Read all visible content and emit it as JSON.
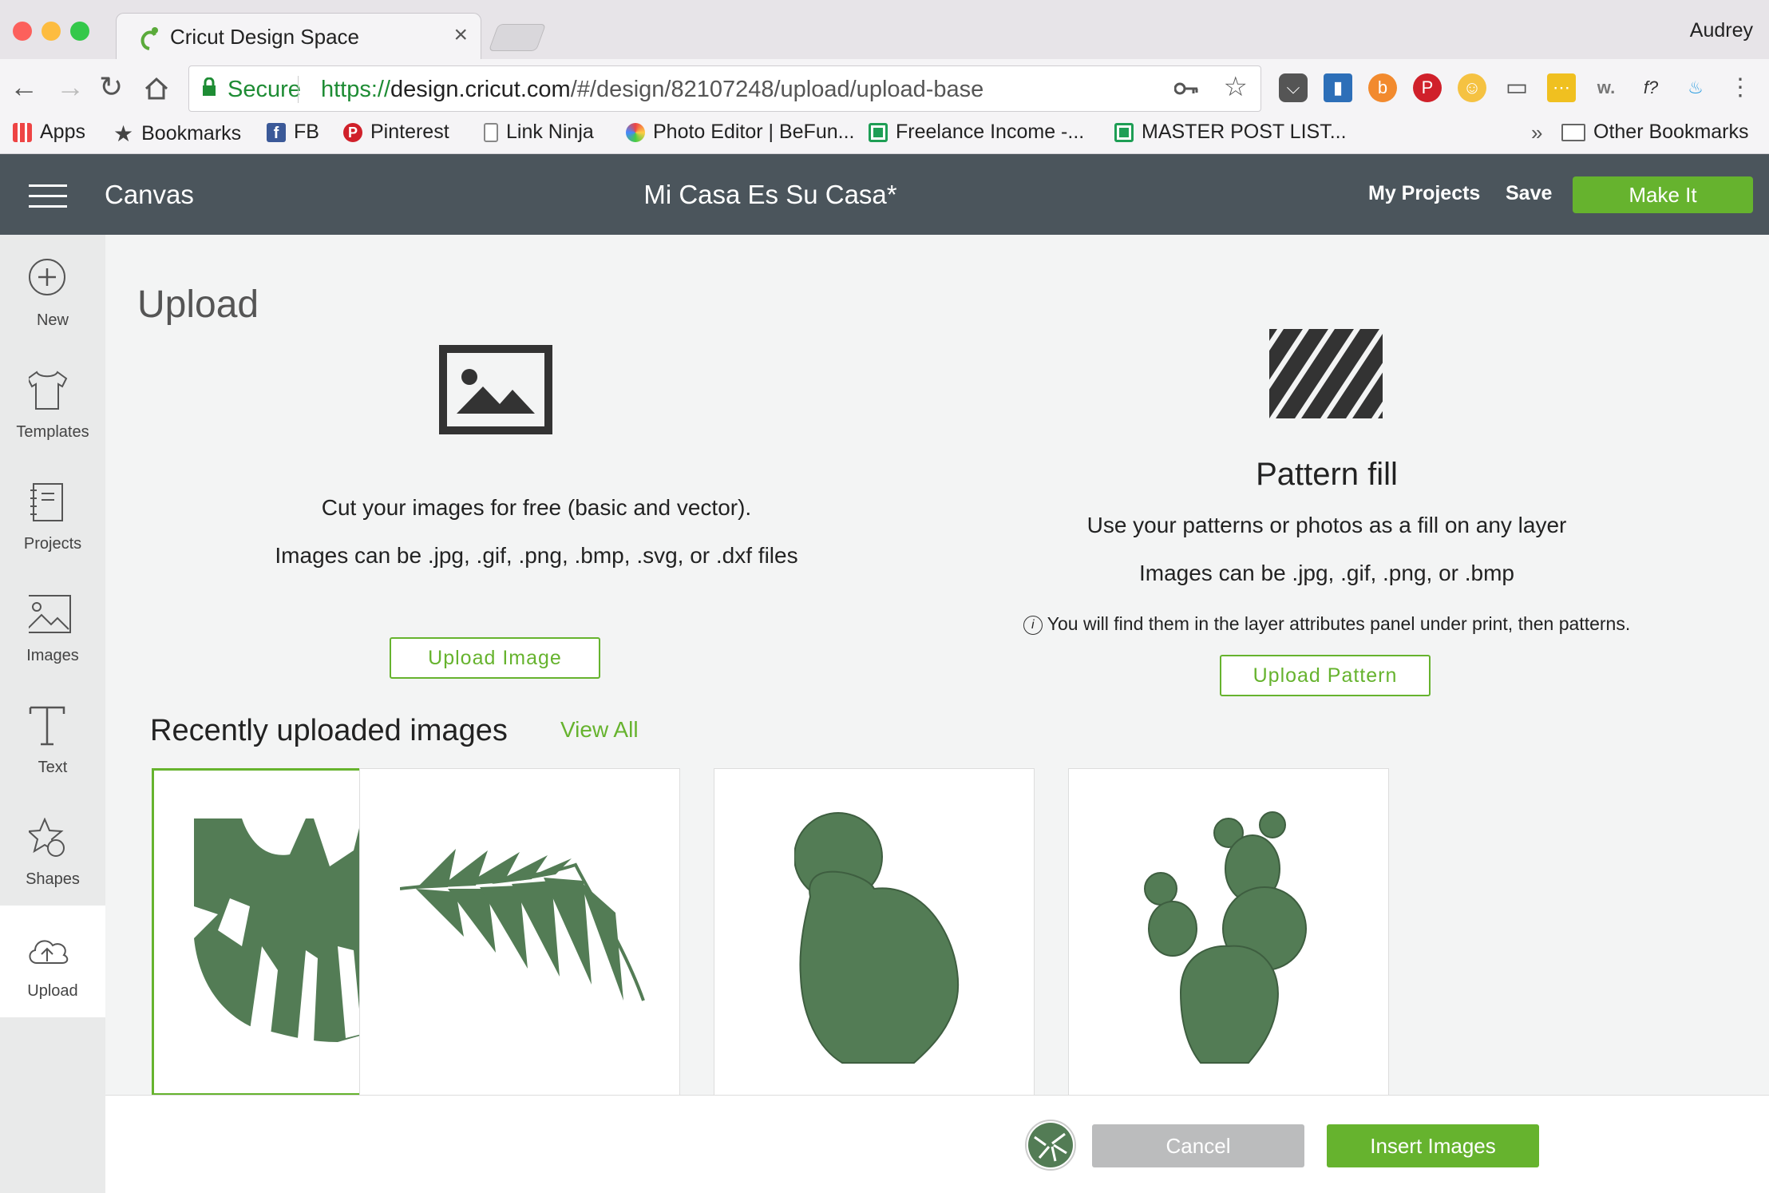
{
  "browser": {
    "tab_title": "Cricut Design Space",
    "user_name": "Audrey",
    "secure_label": "Secure",
    "url_scheme": "https://",
    "url_host": "design.cricut.com",
    "url_path": "/#/design/82107248/upload/upload-base",
    "bookmarks": [
      "Apps",
      "Bookmarks",
      "FB",
      "Pinterest",
      "Link Ninja",
      "Photo Editor | BeFun...",
      "Freelance Income -...",
      "MASTER POST LIST..."
    ],
    "more_bookmarks": "»",
    "other_bookmarks": "Other Bookmarks"
  },
  "header": {
    "section": "Canvas",
    "project_title": "Mi Casa Es Su Casa*",
    "my_projects": "My Projects",
    "save": "Save",
    "make_it": "Make It"
  },
  "sidebar": {
    "items": [
      {
        "label": "New",
        "icon": "plus-circle-icon"
      },
      {
        "label": "Templates",
        "icon": "shirt-icon"
      },
      {
        "label": "Projects",
        "icon": "notebook-icon"
      },
      {
        "label": "Images",
        "icon": "image-icon"
      },
      {
        "label": "Text",
        "icon": "text-icon"
      },
      {
        "label": "Shapes",
        "icon": "shapes-icon"
      },
      {
        "label": "Upload",
        "icon": "cloud-upload-icon"
      }
    ]
  },
  "upload": {
    "heading": "Upload",
    "image_desc_1": "Cut your images for free (basic and vector).",
    "image_desc_2": "Images can be .jpg, .gif, .png, .bmp, .svg, or .dxf files",
    "upload_image_button": "Upload Image",
    "pattern_title": "Pattern fill",
    "pattern_desc_1": "Use your patterns or photos as a fill on any layer",
    "pattern_desc_2": "Images can be .jpg, .gif, .png, or .bmp",
    "pattern_info": "You will find them in the layer attributes panel under print, then patterns.",
    "upload_pattern_button": "Upload Pattern"
  },
  "recent": {
    "heading": "Recently uploaded images",
    "view_all": "View All",
    "images": [
      "monstera-leaf",
      "palm-frond",
      "round-cactus",
      "prickly-pear-cactus"
    ],
    "selected_index": 0
  },
  "footer": {
    "cancel": "Cancel",
    "insert": "Insert Images"
  },
  "colors": {
    "accent": "#66b32e",
    "header_bg": "#4b555c",
    "leaf_green": "#537c55"
  }
}
